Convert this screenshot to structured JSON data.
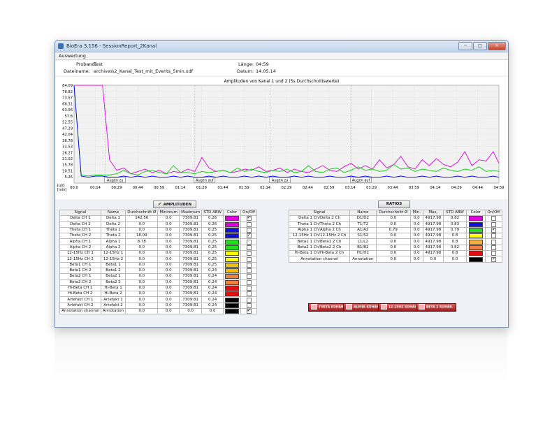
{
  "window": {
    "title": "BioEra 3.156 - SessionReport_2Kanal",
    "buttons": [
      "─",
      "□",
      "✕"
    ]
  },
  "menu": {
    "label": "Auswertung"
  },
  "info": {
    "proband_label": "Proband:",
    "proband_value": "Test",
    "dateiname_label": "Dateiname:",
    "dateiname_value": "archives\\2_Kanal_Test_mit_Events_5min.xdf",
    "laenge_label": "Länge:",
    "laenge_value": "04:59",
    "datum_label": "Datum:",
    "datum_value": "14.05.14"
  },
  "chart_data": {
    "type": "line",
    "title": "Amplituden von Kanal 1 und 2 (5s Durchschnittswerte)",
    "yunit": "[uV]",
    "xunit": "[min]",
    "y_ticks": [
      "84.09",
      "78.82",
      "73.57",
      "68.31",
      "63.06",
      "57.8",
      "52.55",
      "47.29",
      "42.04",
      "36.78",
      "31.53",
      "26.27",
      "21.02",
      "15.78",
      "10.51",
      "5.26"
    ],
    "x_ticks": [
      "00:0",
      "00:14",
      "00:29",
      "00:44",
      "00:59",
      "01:14",
      "01:29",
      "01:44",
      "01:59",
      "02:14",
      "02:29",
      "02:44",
      "02:59",
      "03:14",
      "03:29",
      "03:44",
      "03:59",
      "04:14",
      "04:29",
      "04:44",
      "04:59"
    ],
    "ylim": [
      0,
      84.09
    ],
    "xlim": [
      0,
      299
    ],
    "grid": true,
    "events": [
      {
        "label": "Augen zu",
        "t": 22
      },
      {
        "label": "Augen auf",
        "t": 85
      },
      {
        "label": "Augen zu",
        "t": 138
      },
      {
        "label": "Augen auf",
        "t": 195
      }
    ],
    "series": [
      {
        "color": "#e000e0",
        "x": [
          0,
          5,
          10,
          15,
          20,
          25,
          30,
          35,
          40,
          45,
          50,
          55,
          60,
          65,
          70,
          75,
          80,
          85,
          90,
          95,
          100,
          105,
          110,
          115,
          120,
          125,
          130,
          135,
          140,
          145,
          150,
          155,
          160,
          165,
          170,
          175,
          180,
          185,
          190,
          195,
          200,
          205,
          210,
          215,
          220,
          225,
          230,
          235,
          240,
          245,
          250,
          255,
          260,
          265,
          270,
          275,
          280,
          285,
          290,
          295,
          299
        ],
        "y": [
          84,
          84,
          84,
          84,
          84,
          20,
          11,
          13,
          8,
          10,
          12,
          9,
          11,
          8,
          10,
          9,
          12,
          10,
          22,
          13,
          10,
          11,
          9,
          10,
          12,
          11,
          14,
          10,
          11,
          13,
          9,
          12,
          10,
          9,
          12,
          15,
          11,
          10,
          14,
          17,
          12,
          15,
          12,
          20,
          13,
          16,
          23,
          14,
          12,
          20,
          15,
          21,
          16,
          14,
          18,
          27,
          15,
          20,
          19,
          27,
          17
        ]
      },
      {
        "color": "#00d000",
        "x": [
          0,
          5,
          10,
          15,
          20,
          25,
          30,
          35,
          40,
          45,
          50,
          55,
          60,
          65,
          70,
          75,
          80,
          85,
          90,
          95,
          100,
          105,
          110,
          115,
          120,
          125,
          130,
          135,
          140,
          145,
          150,
          155,
          160,
          165,
          170,
          175,
          180,
          185,
          190,
          195,
          200,
          205,
          210,
          215,
          220,
          225,
          230,
          235,
          240,
          245,
          250,
          255,
          260,
          265,
          270,
          275,
          280,
          285,
          290,
          295,
          299
        ],
        "y": [
          84,
          7,
          6,
          7,
          7,
          7,
          8,
          11,
          8,
          7,
          10,
          11,
          9,
          8,
          15,
          9,
          9,
          8,
          10,
          9,
          10,
          11,
          9,
          13,
          10,
          12,
          10,
          9,
          11,
          10,
          12,
          9,
          10,
          15,
          10,
          9,
          12,
          13,
          9,
          11,
          14,
          11,
          12,
          10,
          11,
          16,
          12,
          13,
          10,
          12,
          11,
          10,
          13,
          11,
          10,
          12,
          11,
          14,
          10,
          11,
          10
        ]
      },
      {
        "color": "#0000ee",
        "x": [
          0,
          5,
          10,
          15,
          20,
          25,
          30,
          35,
          40,
          45,
          50,
          55,
          60,
          65,
          70,
          75,
          80,
          85,
          90,
          95,
          100,
          105,
          110,
          115,
          120,
          125,
          130,
          135,
          140,
          145,
          150,
          155,
          160,
          165,
          170,
          175,
          180,
          185,
          190,
          195,
          200,
          205,
          210,
          215,
          220,
          225,
          230,
          235,
          240,
          245,
          250,
          255,
          260,
          265,
          270,
          275,
          280,
          285,
          290,
          295,
          299
        ],
        "y": [
          84,
          6,
          5,
          6,
          6,
          5,
          5,
          6,
          5,
          6,
          5,
          6,
          5,
          5,
          6,
          5,
          6,
          5,
          5,
          6,
          5,
          6,
          5,
          5,
          6,
          5,
          6,
          5,
          6,
          5,
          5,
          6,
          5,
          6,
          5,
          5,
          6,
          5,
          5,
          6,
          5,
          6,
          5,
          5,
          6,
          5,
          6,
          5,
          5,
          6,
          5,
          6,
          5,
          5,
          6,
          5,
          6,
          5,
          5,
          6,
          5
        ]
      }
    ]
  },
  "amplituden": {
    "button": "AMPLITUDEN",
    "columns": [
      "Signal",
      "Name",
      "Durchschnitt Ø",
      "Minimum",
      "Maximum",
      "STD ABW",
      "Color",
      "On/Off"
    ],
    "rows": [
      {
        "signal": "Delta CH 1",
        "name": "Delta 1",
        "avg": "142.56",
        "min": "0.0",
        "max": "7309.81",
        "std": "0.26",
        "color": "#e000e0",
        "on": true
      },
      {
        "signal": "Delta CH 2",
        "name": "Delta 2",
        "avg": "0.0",
        "min": "0.0",
        "max": "7309.81",
        "std": "0.26",
        "color": "#e000e0",
        "on": false
      },
      {
        "signal": "Theta CH 1",
        "name": "Theta 1",
        "avg": "0.0",
        "min": "0.0",
        "max": "7309.81",
        "std": "0.25",
        "color": "#1010e0",
        "on": false
      },
      {
        "signal": "Theta CH 2",
        "name": "Theta 2",
        "avg": "18.09",
        "min": "0.0",
        "max": "7309.81",
        "std": "0.25",
        "color": "#1010e0",
        "on": true
      },
      {
        "signal": "Alpha CH 1",
        "name": "Alpha 1",
        "avg": "8.78",
        "min": "0.0",
        "max": "7309.81",
        "std": "0.25",
        "color": "#20dd20",
        "on": false
      },
      {
        "signal": "Alpha CH 2",
        "name": "Alpha 2",
        "avg": "0.0",
        "min": "0.0",
        "max": "7309.81",
        "std": "0.25",
        "color": "#20dd20",
        "on": false
      },
      {
        "signal": "12-15Hz CH 1",
        "name": "12-15Hz 1",
        "avg": "0.0",
        "min": "0.0",
        "max": "7309.81",
        "std": "0.25",
        "color": "#ffff00",
        "on": false
      },
      {
        "signal": "12-15Hz CH 2",
        "name": "12-15Hz 2",
        "avg": "0.0",
        "min": "0.0",
        "max": "7309.81",
        "std": "0.25",
        "color": "#ffff00",
        "on": false
      },
      {
        "signal": "Beta1 CH 1",
        "name": "Beta1 1",
        "avg": "0.0",
        "min": "0.0",
        "max": "7309.81",
        "std": "0.25",
        "color": "#f0c000",
        "on": false
      },
      {
        "signal": "Beta1 CH 2",
        "name": "Beta1 2",
        "avg": "0.0",
        "min": "0.0",
        "max": "7309.81",
        "std": "0.24",
        "color": "#f0c000",
        "on": false
      },
      {
        "signal": "Beta2 CH 1",
        "name": "Beta2 1",
        "avg": "0.0",
        "min": "0.0",
        "max": "7309.81",
        "std": "0.24",
        "color": "#f08040",
        "on": false
      },
      {
        "signal": "Beta2 CH 2",
        "name": "Beta2 2",
        "avg": "0.0",
        "min": "0.0",
        "max": "7309.81",
        "std": "0.24",
        "color": "#f08040",
        "on": false
      },
      {
        "signal": "Hi-Beta CH 1",
        "name": "Hi-Beta 1",
        "avg": "0.0",
        "min": "0.0",
        "max": "7309.81",
        "std": "0.24",
        "color": "#e01010",
        "on": false
      },
      {
        "signal": "Hi-Beta CH 2",
        "name": "Hi-Beta 2",
        "avg": "0.0",
        "min": "0.0",
        "max": "7309.81",
        "std": "0.24",
        "color": "#e01010",
        "on": false
      },
      {
        "signal": "Artefakt CH 1",
        "name": "Artefakt 1",
        "avg": "0.0",
        "min": "0.0",
        "max": "7309.81",
        "std": "0.24",
        "color": "#000000",
        "on": false
      },
      {
        "signal": "Artefakt CH 2",
        "name": "Artefakt 2",
        "avg": "0.0",
        "min": "0.0",
        "max": "7309.81",
        "std": "0.24",
        "color": "#000000",
        "on": false
      },
      {
        "signal": "Annotation channel",
        "name": "Annotation",
        "avg": "0.0",
        "min": "0.0",
        "max": "0.0",
        "std": "0.0",
        "color": "#000000",
        "on": true
      }
    ]
  },
  "ratios": {
    "button": "RATIOS",
    "columns": [
      "Signal",
      "Name",
      "Durchschnitt Ø",
      "Min.",
      "Max.",
      "STD ABW",
      "Color",
      "On/Off"
    ],
    "rows": [
      {
        "signal": "Delta 1 Ch/Delta 2 Ch",
        "name": "D1/D2",
        "avg": "0.0",
        "min": "0.0",
        "max": "4917.98",
        "std": "0.82",
        "color": "#e000e0",
        "on": false
      },
      {
        "signal": "Theta 1 Ch/Theta 2 Ch",
        "name": "T1/T2",
        "avg": "0.0",
        "min": "0.0",
        "max": "4917.98",
        "std": "0.83",
        "color": "#1010e0",
        "on": false
      },
      {
        "signal": "Alpha 1 Ch/Alpha 2 Ch",
        "name": "A1/A2",
        "avg": "0.79",
        "min": "0.0",
        "max": "4917.98",
        "std": "0.79",
        "color": "#20dd20",
        "on": true
      },
      {
        "signal": "12-15Hz 1 Ch/12-15Hz 2 Ch",
        "name": "S1/S2",
        "avg": "0.0",
        "min": "0.0",
        "max": "4917.98",
        "std": "0.8",
        "color": "#ffff00",
        "on": false
      },
      {
        "signal": "Beta1 1 Ch/Beta1 2 Ch",
        "name": "L1/L2",
        "avg": "0.0",
        "min": "0.0",
        "max": "4917.98",
        "std": "0.8",
        "color": "#f0b040",
        "on": false
      },
      {
        "signal": "Beta2 1 Ch/Beta2 2 Ch",
        "name": "B1/B2",
        "avg": "0.0",
        "min": "0.0",
        "max": "4917.98",
        "std": "0.82",
        "color": "#f08040",
        "on": false
      },
      {
        "signal": "Hi-Beta 1 Ch/Hi-Beta 2 Ch",
        "name": "H1/H2",
        "avg": "0.0",
        "min": "0.0",
        "max": "4917.98",
        "std": "0.8",
        "color": "#e01010",
        "on": false
      },
      {
        "signal": "Annotation channel",
        "name": "Annotation",
        "avg": "0.0",
        "min": "0.0",
        "max": "0.0",
        "std": "0.0",
        "color": "#000000",
        "on": true
      }
    ]
  },
  "ratio_buttons": [
    "THETA KOHÄR.",
    "ALPHA KOHÄR.",
    "12-15HZ KOHÄR.",
    "BETA 2 KOHÄR."
  ]
}
